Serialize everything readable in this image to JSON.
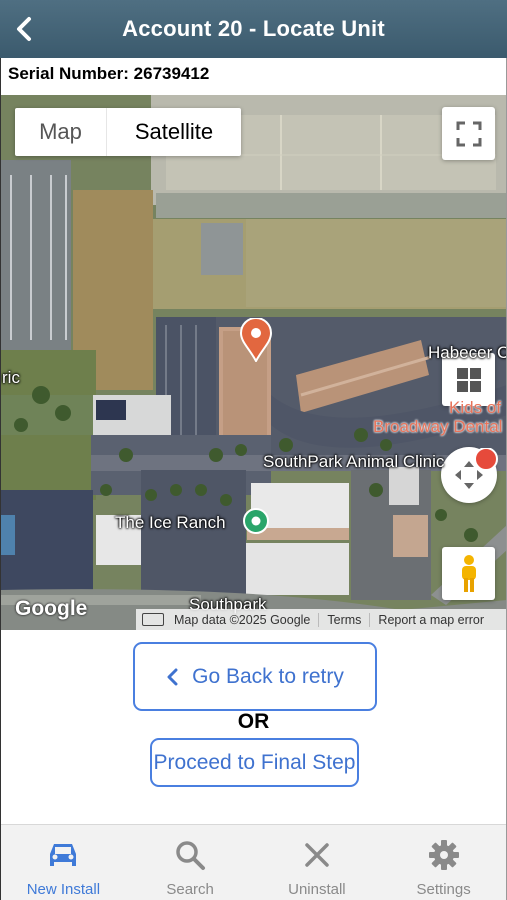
{
  "header": {
    "title": "Account 20 - Locate Unit",
    "back_icon": "chevron-left-icon"
  },
  "serial": {
    "label": "Serial Number:",
    "value": "26739412"
  },
  "map": {
    "type_options": {
      "map": "Map",
      "satellite": "Satellite"
    },
    "selected_type": "Satellite",
    "labels": {
      "south_park_animal": "SouthPark Animal Clinic",
      "ice_ranch": "The Ice Ranch",
      "broadway_dental": "Broadway Dental",
      "kids_of": "Kids of",
      "habebe": "Habecer C",
      "ric": "ric",
      "southpark": "Southpark"
    },
    "attribution": {
      "logo": "Google",
      "map_data": "Map data ©2025 Google",
      "terms": "Terms",
      "report": "Report a map error"
    },
    "marker_color": "#e2673f",
    "place_marker_color": "#2aa56a"
  },
  "actions": {
    "retry_label": "Go Back to retry",
    "or_label": "OR",
    "proceed_label": "Proceed to Final Step",
    "accent": "#3f72cf"
  },
  "nav": {
    "items": [
      {
        "label": "New Install",
        "icon": "car-icon",
        "active": true
      },
      {
        "label": "Search",
        "icon": "search-icon",
        "active": false
      },
      {
        "label": "Uninstall",
        "icon": "close-icon",
        "active": false
      },
      {
        "label": "Settings",
        "icon": "gear-icon",
        "active": false
      }
    ]
  }
}
